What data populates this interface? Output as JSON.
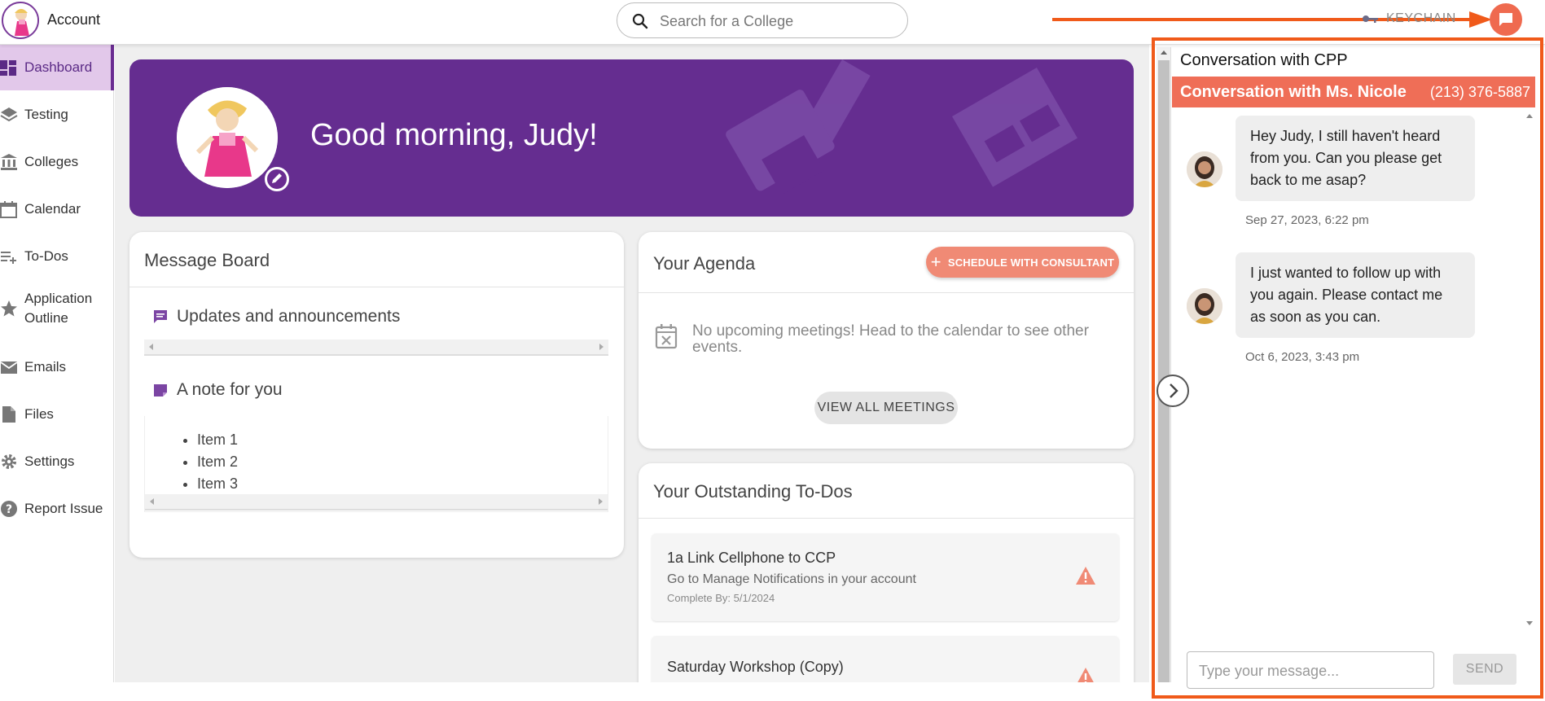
{
  "topbar": {
    "account_label": "Account",
    "search_placeholder": "Search for a College",
    "keychain_label": "KEYCHAIN"
  },
  "sidebar": {
    "items": [
      {
        "label": "Dashboard",
        "icon": "dashboard-icon",
        "active": true
      },
      {
        "label": "Testing",
        "icon": "layers-icon"
      },
      {
        "label": "Colleges",
        "icon": "institution-icon"
      },
      {
        "label": "Calendar",
        "icon": "calendar-icon"
      },
      {
        "label": "To-Dos",
        "icon": "playlist-add-icon"
      },
      {
        "label": "Application Outline",
        "icon": "star-icon"
      },
      {
        "label": "Emails",
        "icon": "mail-icon"
      },
      {
        "label": "Files",
        "icon": "file-icon"
      },
      {
        "label": "Settings",
        "icon": "gear-icon"
      },
      {
        "label": "Report Issue",
        "icon": "help-icon"
      }
    ],
    "accent_color": "#6a2c91"
  },
  "banner": {
    "greeting": "Good morning, Judy!",
    "color": "#652d90"
  },
  "message_board": {
    "title": "Message Board",
    "updates_heading": "Updates and announcements",
    "note_heading": "A note for you",
    "note_items": [
      "Item 1",
      "Item 2",
      "Item 3"
    ]
  },
  "agenda": {
    "title": "Your Agenda",
    "schedule_button": "SCHEDULE WITH CONSULTANT",
    "empty_text": "No upcoming meetings! Head to the calendar to see other events.",
    "view_all_button": "VIEW ALL MEETINGS"
  },
  "todos": {
    "title": "Your Outstanding To-Dos",
    "items": [
      {
        "title": "1a Link Cellphone to CCP",
        "description": "Go to Manage Notifications in your account",
        "due": "Complete By: 5/1/2024"
      },
      {
        "title": "Saturday Workshop (Copy)"
      }
    ]
  },
  "chat": {
    "header_title": "Conversation with CPP",
    "conversation_name": "Conversation with Ms. Nicole",
    "phone": "(213) 376-5887",
    "messages": [
      {
        "text": "Hey Judy, I still haven't heard from you. Can you please get back to me asap?",
        "time": "Sep 27, 2023, 6:22 pm"
      },
      {
        "text": "I just wanted to follow up with you again. Please contact me as soon as you can.",
        "time": "Oct 6, 2023, 3:43 pm"
      }
    ],
    "input_placeholder": "Type your message...",
    "send_label": "SEND",
    "accent_color": "#ef6e57",
    "highlight_color": "#f05a1a"
  }
}
